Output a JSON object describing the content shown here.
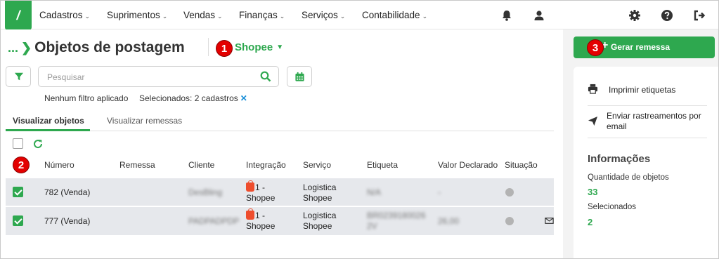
{
  "nav": {
    "logo": "/",
    "menu": [
      {
        "label": "Cadastros"
      },
      {
        "label": "Suprimentos"
      },
      {
        "label": "Vendas"
      },
      {
        "label": "Finanças"
      },
      {
        "label": "Serviços"
      },
      {
        "label": "Contabilidade"
      }
    ],
    "icons": [
      "bell-icon",
      "user-icon",
      "gear-icon",
      "help-icon",
      "logout-icon"
    ]
  },
  "page": {
    "breadcrumb_dots": "...",
    "title": "Objetos de postagem",
    "store_select": "Shopee",
    "badges": [
      "1",
      "2",
      "3"
    ]
  },
  "search": {
    "placeholder": "Pesquisar",
    "value": ""
  },
  "filters": {
    "none_applied": "Nenhum filtro aplicado",
    "selected": "Selecionados: 2 cadastros",
    "clear_icon": "✕"
  },
  "tabs": [
    {
      "label": "Visualizar objetos",
      "active": true
    },
    {
      "label": "Visualizar remessas",
      "active": false
    }
  ],
  "table": {
    "columns": [
      "Número",
      "Remessa",
      "Cliente",
      "Integração",
      "Serviço",
      "Etiqueta",
      "Valor Declarado",
      "Situação"
    ],
    "rows": [
      {
        "checked": true,
        "numero": "782 (Venda)",
        "remessa": "",
        "cliente": "DesBling",
        "integracao_line1": "1 -",
        "integracao_line2": "Shopee",
        "servico_line1": "Logistica",
        "servico_line2": "Shopee",
        "etiqueta_line1": "N/A",
        "etiqueta_line2": "",
        "valor": "-",
        "has_mail": false
      },
      {
        "checked": true,
        "numero": "777 (Venda)",
        "remessa": "",
        "cliente": "PADPADPDP",
        "integracao_line1": "1 -",
        "integracao_line2": "Shopee",
        "servico_line1": "Logistica",
        "servico_line2": "Shopee",
        "etiqueta_line1": "BR0239180026",
        "etiqueta_line2": "2V",
        "valor": "26,00",
        "has_mail": true
      }
    ]
  },
  "side": {
    "gerar_label": "Gerar remessa",
    "actions": [
      {
        "label": "Imprimir etiquetas",
        "icon": "printer-icon"
      },
      {
        "label_line1": "Enviar rastreamentos por",
        "label_line2": "email",
        "icon": "send-icon"
      }
    ],
    "info_title": "Informações",
    "qty_label": "Quantidade de objetos",
    "qty_value": "33",
    "selected_label": "Selecionados",
    "selected_value": "2"
  },
  "colors": {
    "accent": "#2ea84f",
    "badge": "#e30000",
    "row_bg": "#e6e8ec"
  }
}
